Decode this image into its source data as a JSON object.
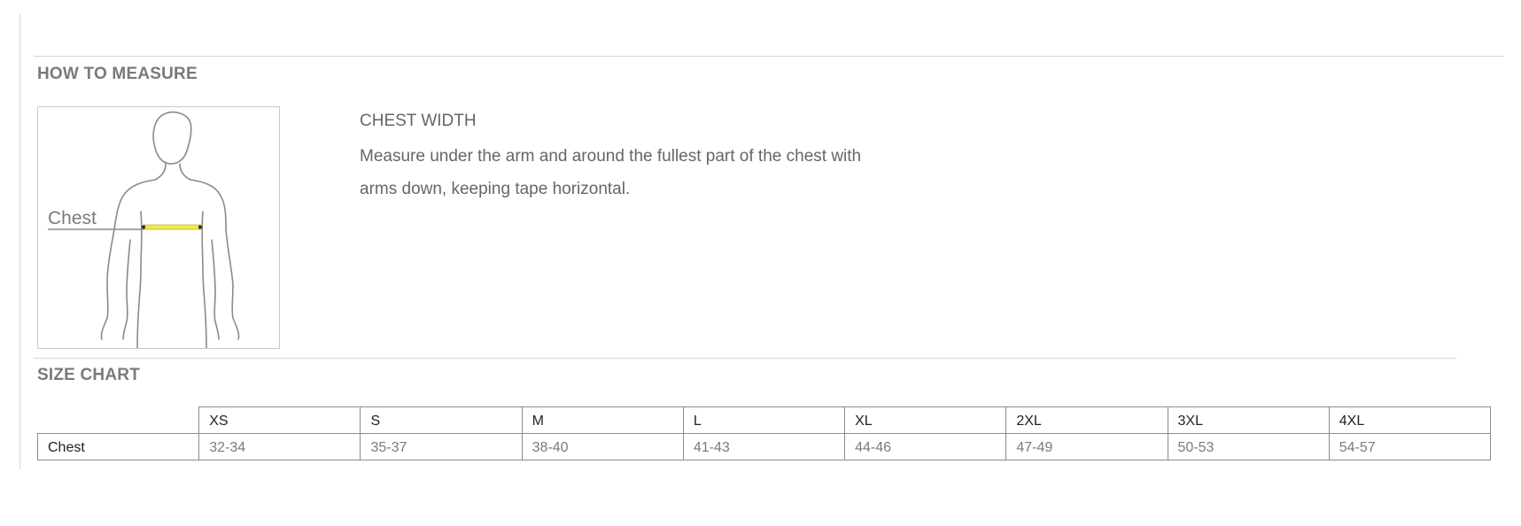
{
  "how_to_measure": {
    "heading": "HOW TO MEASURE",
    "figure_label": "Chest",
    "title": "CHEST WIDTH",
    "description": "Measure under the arm and around the fullest part of the chest with arms down, keeping tape horizontal."
  },
  "size_chart": {
    "heading": "SIZE CHART",
    "sizes": [
      "XS",
      "S",
      "M",
      "L",
      "XL",
      "2XL",
      "3XL",
      "4XL"
    ],
    "rows": [
      {
        "label": "Chest",
        "values": [
          "32-34",
          "35-37",
          "38-40",
          "41-43",
          "44-46",
          "47-49",
          "50-53",
          "54-57"
        ]
      }
    ]
  },
  "colors": {
    "tape": "#f2e94e",
    "outline": "#8a8a8a",
    "rule": "#d6d6d6"
  }
}
